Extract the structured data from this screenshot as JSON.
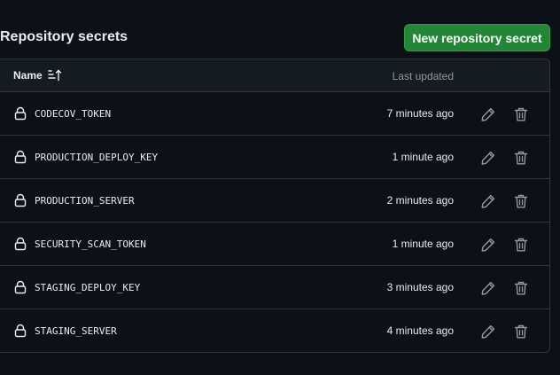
{
  "header": {
    "title": "Repository secrets",
    "new_secret_label": "New repository secret"
  },
  "table": {
    "columns": {
      "name": "Name",
      "last_updated": "Last updated"
    },
    "sort_icon": "sort-ascending-icon",
    "rows": [
      {
        "name": "CODECOV_TOKEN",
        "updated": "7 minutes ago"
      },
      {
        "name": "PRODUCTION_DEPLOY_KEY",
        "updated": "1 minute ago"
      },
      {
        "name": "PRODUCTION_SERVER",
        "updated": "2 minutes ago"
      },
      {
        "name": "SECURITY_SCAN_TOKEN",
        "updated": "1 minute ago"
      },
      {
        "name": "STAGING_DEPLOY_KEY",
        "updated": "3 minutes ago"
      },
      {
        "name": "STAGING_SERVER",
        "updated": "4 minutes ago"
      }
    ],
    "row_icons": {
      "lock": "lock-icon",
      "edit": "pencil-icon",
      "delete": "trash-icon"
    }
  },
  "colors": {
    "background": "#0d1117",
    "header_background": "#151b23",
    "border": "#30363d",
    "primary_button": "#238636",
    "text": "#e6edf3",
    "muted_text": "#9198a1",
    "icon": "#9198a1"
  }
}
